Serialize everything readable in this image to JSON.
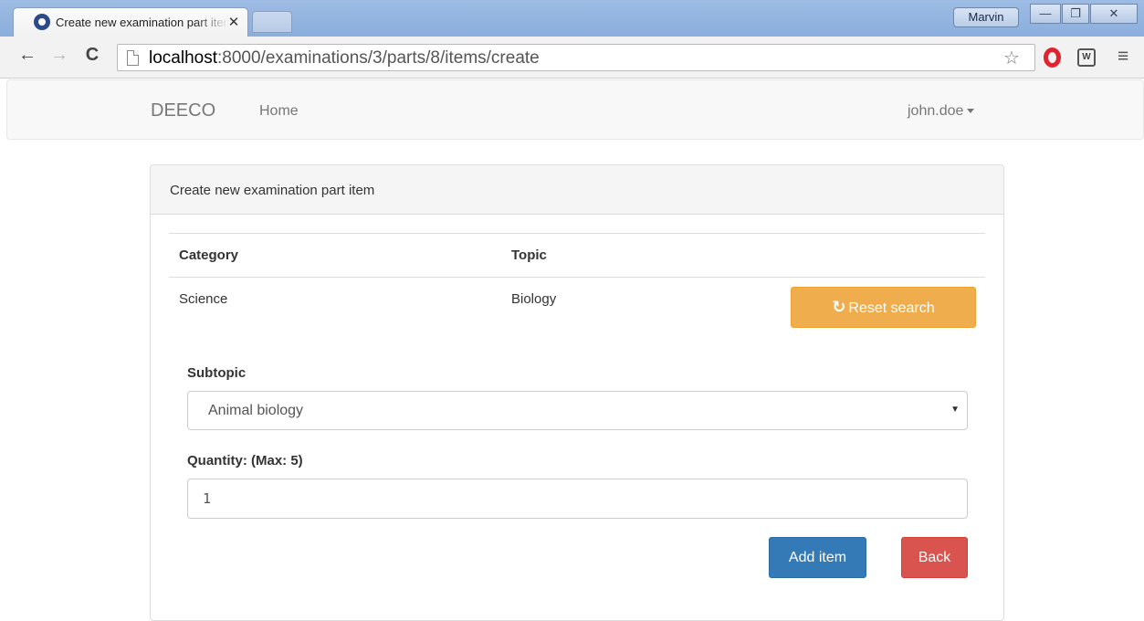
{
  "browser": {
    "tab_title": "Create new examination part item",
    "tab_close": "✕",
    "profile_name": "Marvin",
    "url_host": "localhost",
    "url_rest": ":8000/examinations/3/parts/8/items/create",
    "window_buttons": {
      "minimize": "—",
      "restore": "❐",
      "close": "✕"
    },
    "nav": {
      "back": "←",
      "forward": "→",
      "reload": "C"
    },
    "star": "☆",
    "menu": "≡",
    "ext_label": "W"
  },
  "navbar": {
    "brand": "DEECO",
    "home": "Home",
    "user": "john.doe"
  },
  "panel": {
    "title": "Create new examination part item",
    "table": {
      "headers": [
        "Category",
        "Topic"
      ],
      "row": [
        "Science",
        "Biology"
      ]
    },
    "reset_icon": "↻",
    "reset_label": "Reset search",
    "subtopic_label": "Subtopic",
    "subtopic_value": "Animal biology",
    "select_arrow": "▼",
    "quantity_label": "Quantity: (Max: 5)",
    "quantity_value": "1",
    "add_label": "Add item",
    "back_label": "Back"
  }
}
